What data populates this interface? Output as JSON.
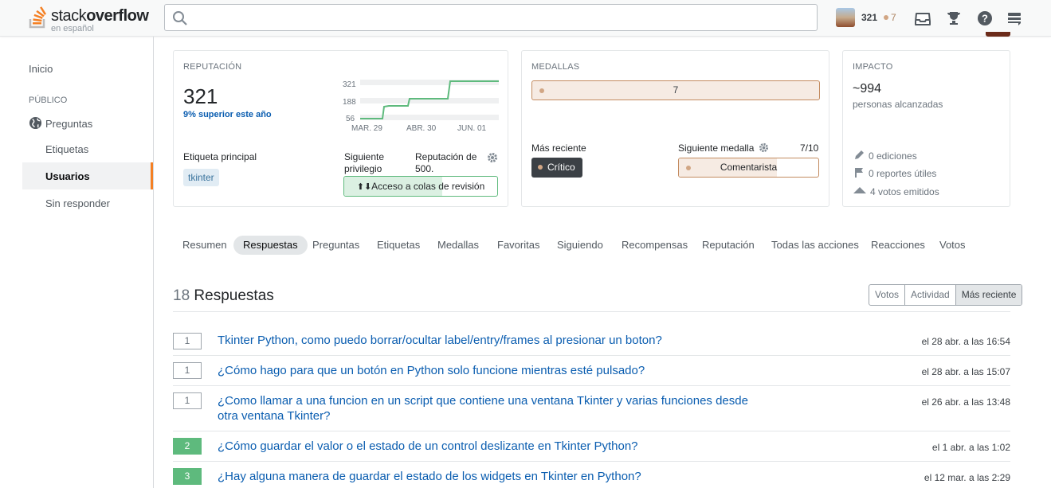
{
  "header": {
    "logo_word1": "stack",
    "logo_word2": "overflow",
    "logo_sub": "en español",
    "search_placeholder": "",
    "reputation": "321",
    "bronze_count": "7"
  },
  "sidebar": {
    "home": "Inicio",
    "public_section": "PÚBLICO",
    "questions": "Preguntas",
    "tags": "Etiquetas",
    "users": "Usuarios",
    "unanswered": "Sin responder"
  },
  "reputation_card": {
    "heading": "REPUTACIÓN",
    "value": "321",
    "top_percent": "9% superior este año",
    "chart_y_labels": [
      "321",
      "188",
      "56"
    ],
    "chart_x_labels": [
      "MAR. 29",
      "ABR. 30",
      "JUN. 01"
    ],
    "main_tag_label": "Etiqueta principal",
    "main_tag": "tkinter",
    "next_priv_label": "Siguiente privilegio",
    "next_priv_rep": "Reputación de 500.",
    "next_priv_name": "Acceso a colas de revisión",
    "next_priv_progress": 0.64
  },
  "badges_card": {
    "heading": "MEDALLAS",
    "bronze_total": "7",
    "recent_label": "Más reciente",
    "recent_badge": "Crítico",
    "next_label": "Siguiente medalla",
    "next_progress": "7/10",
    "next_badge": "Comentarista",
    "next_fill": 0.7
  },
  "impact_card": {
    "heading": "IMPACTO",
    "reached": "~994",
    "reached_label": "personas alcanzadas",
    "edits": "0 ediciones",
    "flags": "0 reportes útiles",
    "votes": "4 votos emitidos"
  },
  "tabs": [
    "Resumen",
    "Respuestas",
    "Preguntas",
    "Etiquetas",
    "Medallas",
    "Favoritas",
    "Siguiendo",
    "Recompensas",
    "Reputación",
    "Todas las acciones",
    "Reacciones",
    "Votos"
  ],
  "answers": {
    "count": "18",
    "title": "Respuestas",
    "sort": [
      "Votos",
      "Actividad",
      "Más reciente"
    ],
    "items": [
      {
        "score": "1",
        "accepted": false,
        "title": "Tkinter Python, como puedo borrar/ocultar label/entry/frames al presionar un boton?",
        "date": "el 28 abr. a las 16:54"
      },
      {
        "score": "1",
        "accepted": false,
        "title": "¿Cómo hago para que un botón en Python solo funcione mientras esté pulsado?",
        "date": "el 28 abr. a las 15:07"
      },
      {
        "score": "1",
        "accepted": false,
        "title": "¿Como llamar a una funcion en un script que contiene una ventana Tkinter y varias funciones desde otra ventana Tkinter?",
        "date": "el 26 abr. a las 13:48"
      },
      {
        "score": "2",
        "accepted": true,
        "title": "¿Cómo guardar el valor o el estado de un control deslizante en Tkinter Python?",
        "date": "el 1 abr. a las 1:02"
      },
      {
        "score": "3",
        "accepted": true,
        "title": "¿Hay alguna manera de guardar el estado de los widgets en Tkinter en Python?",
        "date": "el 12 mar. a las 2:29"
      }
    ]
  },
  "colors": {
    "accent": "#f48024",
    "link": "#0a5db0",
    "accepted": "#5eba7d",
    "bronze": "#d1a684",
    "chart_line": "#5eba7d"
  }
}
